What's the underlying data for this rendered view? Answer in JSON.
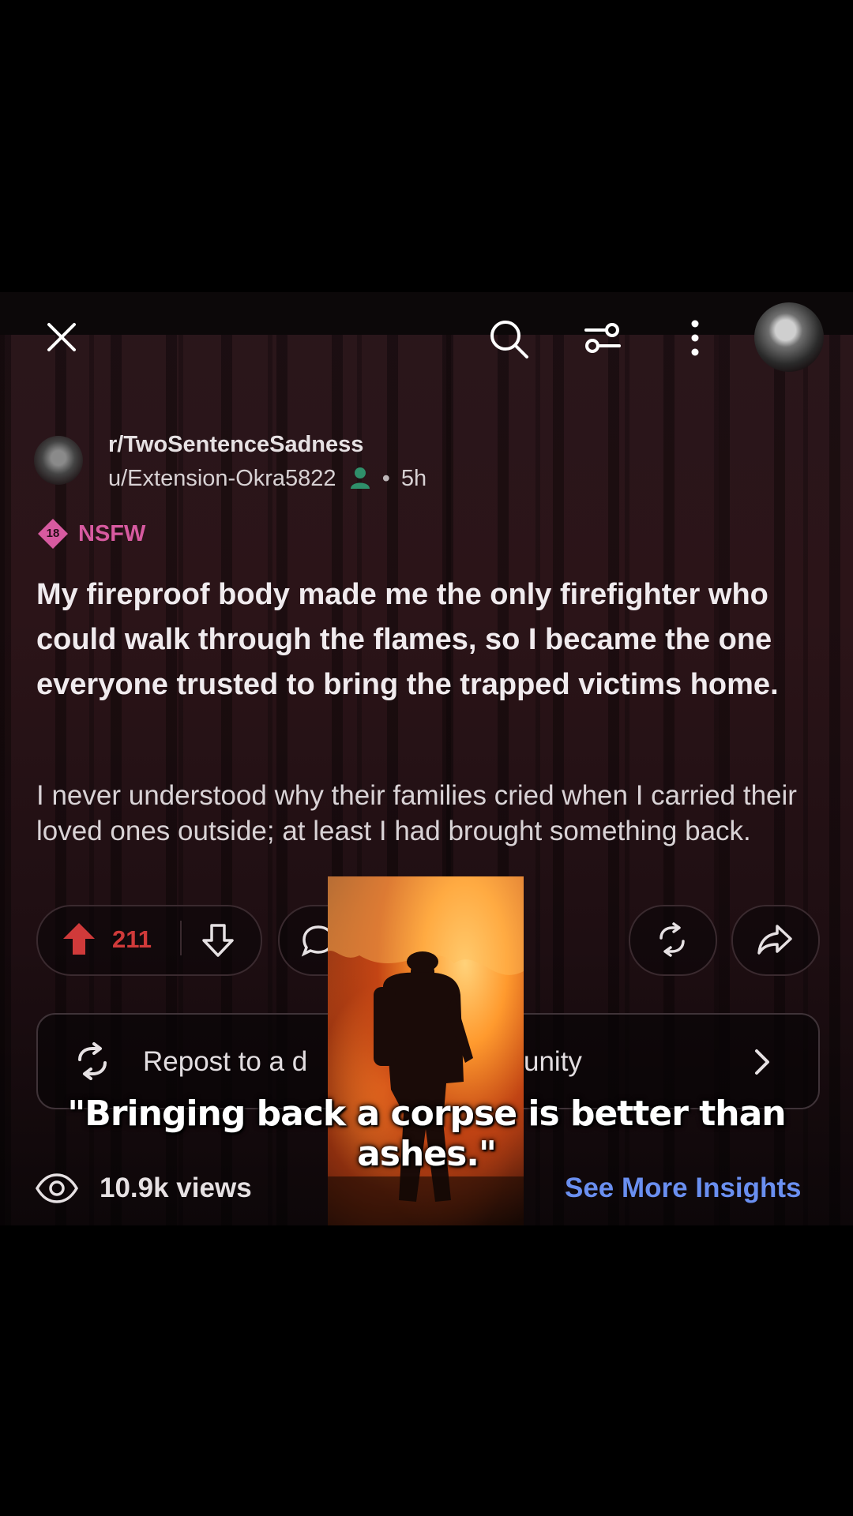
{
  "post": {
    "subreddit": "r/TwoSentenceSadness",
    "author": "u/Extension-Okra5822",
    "dot": "•",
    "age": "5h",
    "nsfw_badge": "18",
    "nsfw_label": "NSFW",
    "title": "My fireproof body made me the only firefighter who could walk through the flames, so I became the one everyone trusted to bring the trapped victims home.",
    "body": "I never understood why their families cried when I carried their loved ones outside; at least I had brought something back."
  },
  "actions": {
    "upvotes": "211"
  },
  "repost": {
    "label_visible_left": "Repost to a d",
    "label_visible_right": "unity"
  },
  "insights": {
    "views": "10.9k views",
    "link": "See More Insights"
  },
  "video": {
    "caption": "\"Bringing back a corpse is better than ashes.\""
  },
  "icons": {
    "close": "close-icon",
    "search": "search-icon",
    "filter": "filter-icon",
    "more": "more-vertical-icon",
    "upvote": "upvote-arrow-icon",
    "downvote": "downvote-arrow-icon",
    "comment": "comment-icon",
    "award": "repost-cycle-icon",
    "share": "share-arrow-icon",
    "repost": "repost-icon",
    "chevron": "chevron-right-icon",
    "views": "eye-icon"
  },
  "colors": {
    "upvote": "#d03a3a",
    "nsfw": "#d75aa0",
    "link": "#6a8ff0",
    "online": "#2f8f6a"
  }
}
